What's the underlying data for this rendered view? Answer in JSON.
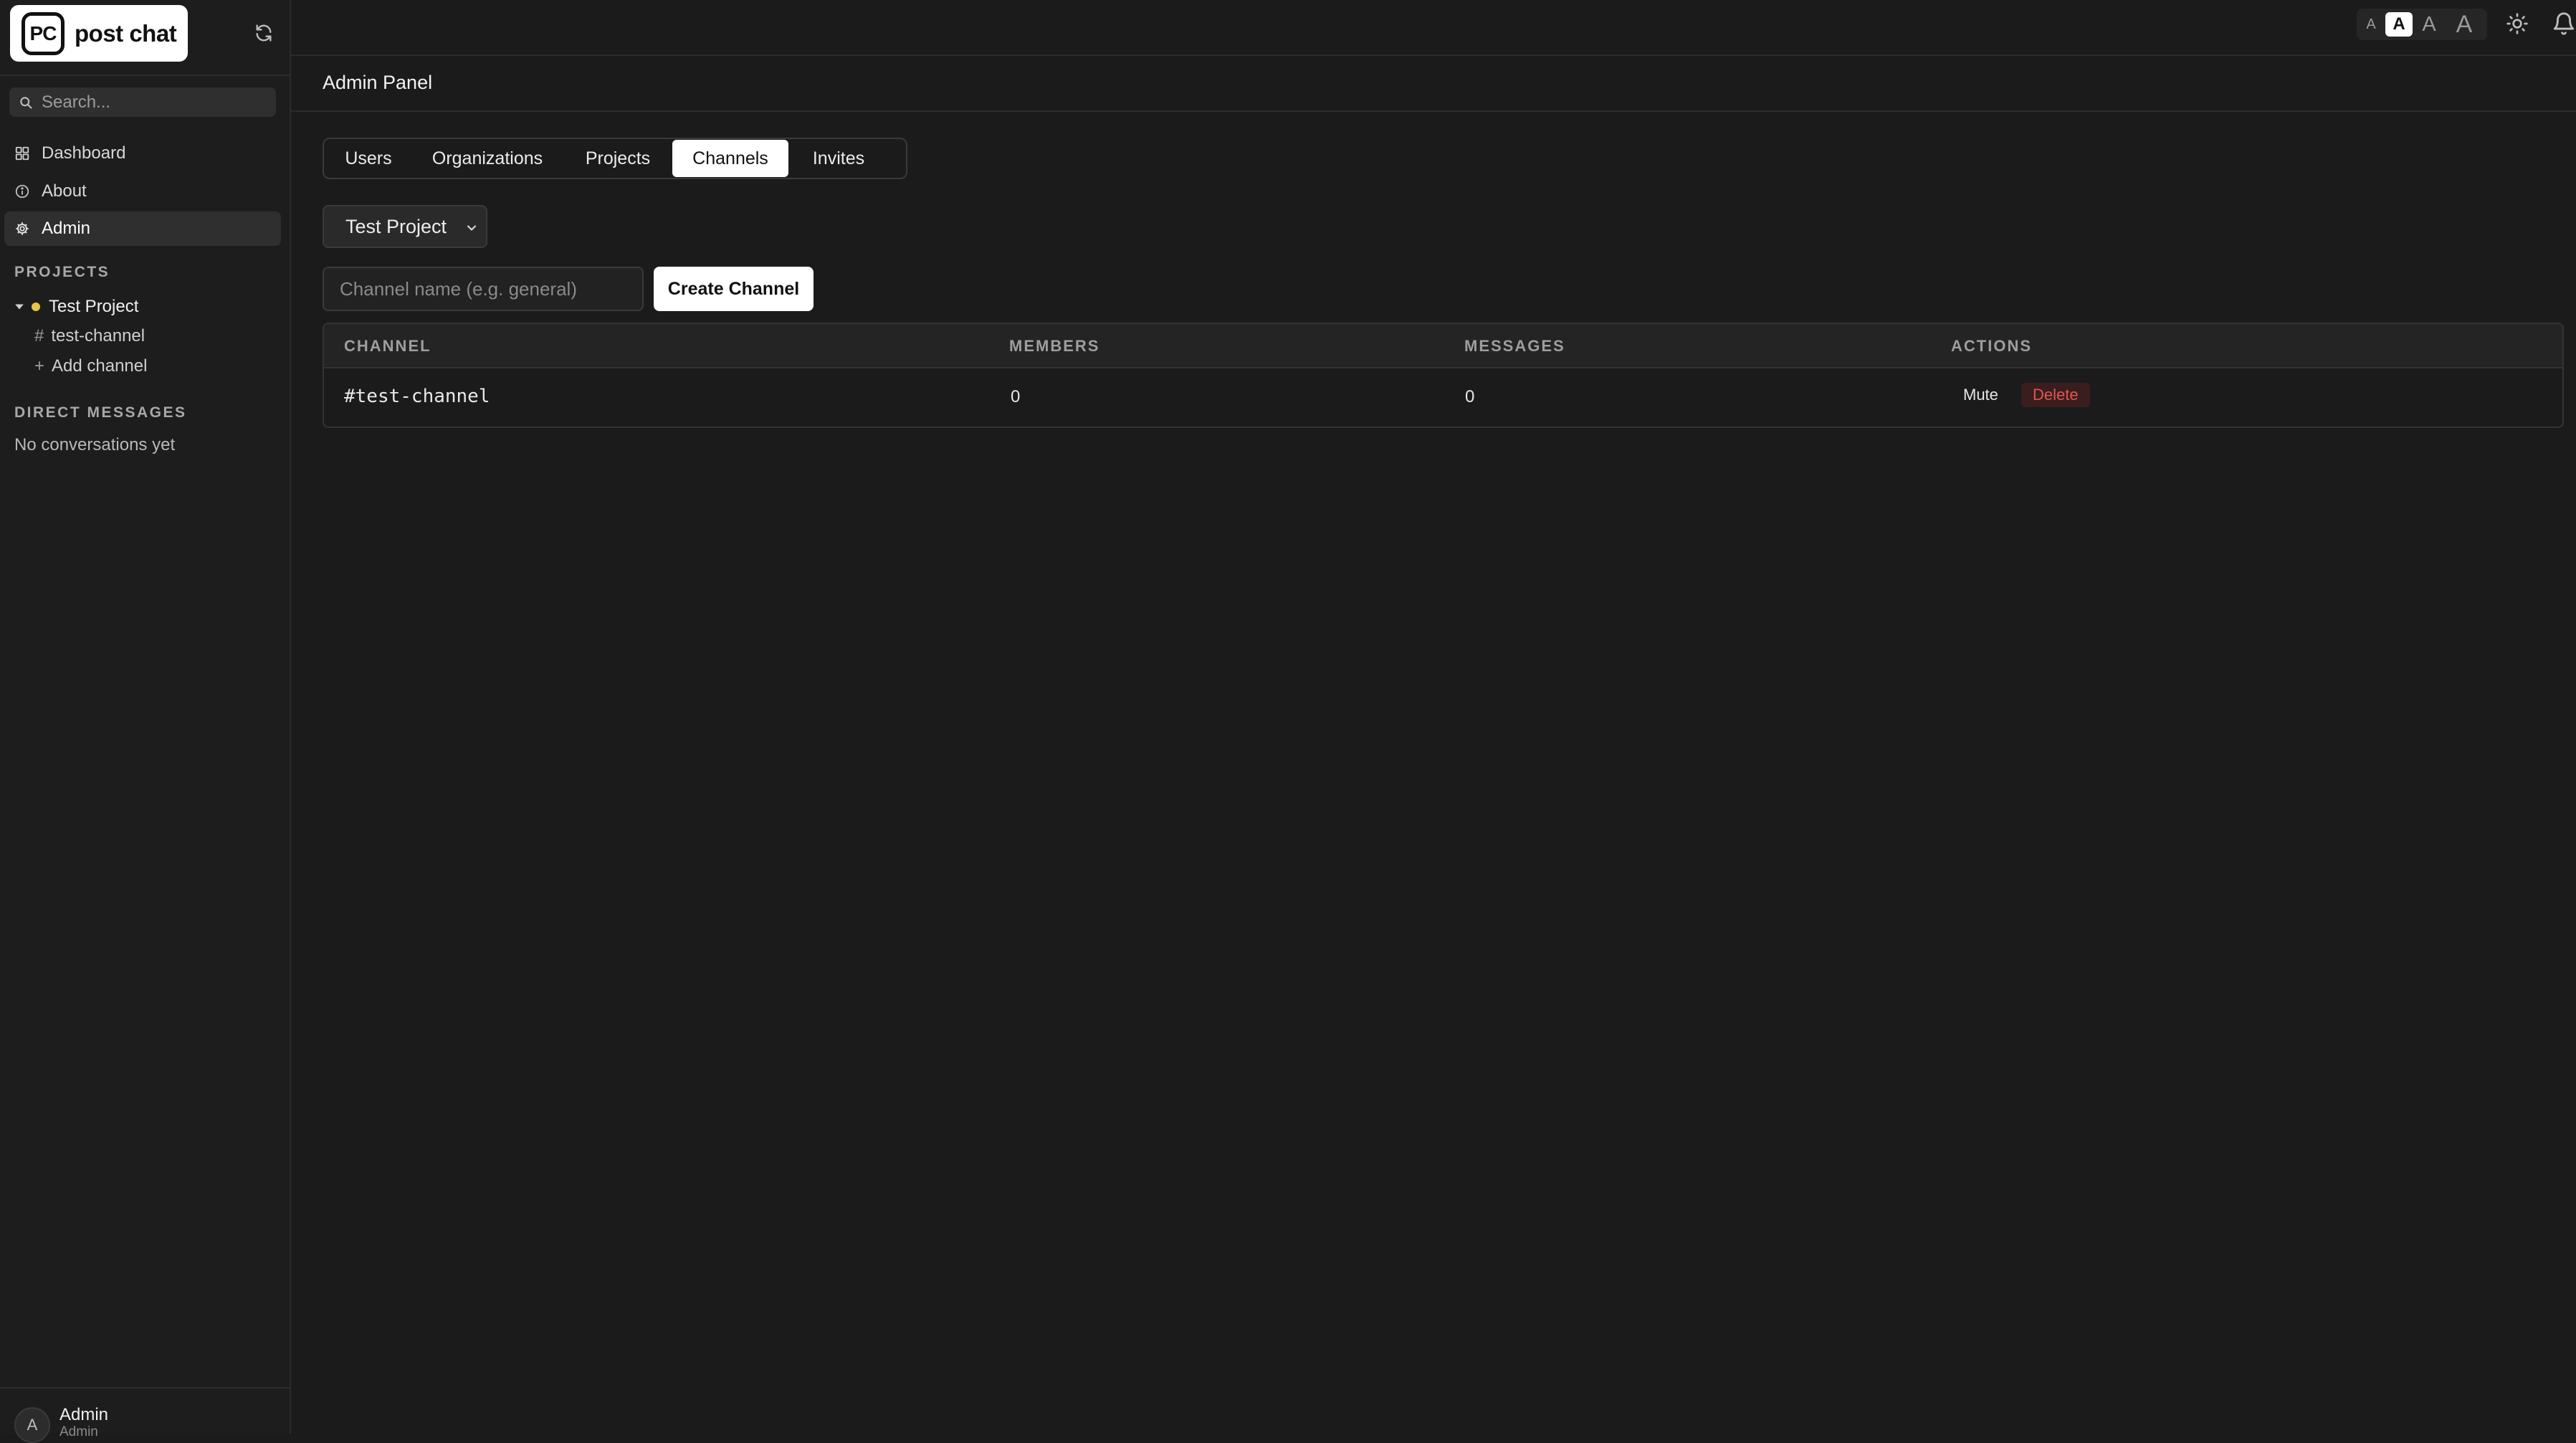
{
  "app": {
    "logo_mark": "PC",
    "logo_text": "post chat"
  },
  "search": {
    "placeholder": "Search..."
  },
  "nav": {
    "dashboard": "Dashboard",
    "about": "About",
    "admin": "Admin"
  },
  "sidebar": {
    "projects_label": "PROJECTS",
    "project_name": "Test Project",
    "project_dot_color": "#e8c547",
    "channel_name": "test-channel",
    "add_channel": "Add channel",
    "dm_label": "DIRECT MESSAGES",
    "dm_empty": "No conversations yet"
  },
  "user": {
    "initial": "A",
    "name": "Admin",
    "role": "Admin"
  },
  "topbar": {
    "font_sizes": [
      "A",
      "A",
      "A",
      "A"
    ],
    "active_font_size_index": 1
  },
  "page": {
    "title": "Admin Panel"
  },
  "tabs": {
    "users": "Users",
    "organizations": "Organizations",
    "projects": "Projects",
    "channels": "Channels",
    "invites": "Invites",
    "active": "Channels"
  },
  "project_select": {
    "value": "Test Project"
  },
  "create_channel": {
    "placeholder": "Channel name (e.g. general)",
    "button": "Create Channel"
  },
  "table": {
    "headers": {
      "channel": "CHANNEL",
      "members": "MEMBERS",
      "messages": "MESSAGES",
      "actions": "ACTIONS"
    },
    "rows": [
      {
        "channel": "#test-channel",
        "members": "0",
        "messages": "0",
        "mute": "Mute",
        "delete": "Delete"
      }
    ]
  },
  "colors": {
    "background": "#1b1b1b",
    "delete_red": "#e05555"
  }
}
